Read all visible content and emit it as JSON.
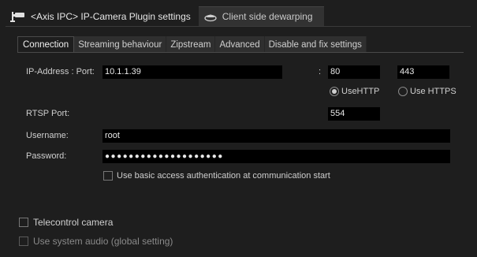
{
  "top_tabs": [
    {
      "label": "<Axis IPC> IP-Camera Plugin settings",
      "icon": "camera-icon"
    },
    {
      "label": "Client side dewarping",
      "icon": "dome-camera-icon"
    }
  ],
  "sub_tabs": [
    {
      "label": "Connection",
      "active": true
    },
    {
      "label": "Streaming behaviour"
    },
    {
      "label": "Zipstream"
    },
    {
      "label": "Advanced"
    },
    {
      "label": "Disable and fix settings"
    }
  ],
  "connection": {
    "ip_label": "IP-Address : Port:",
    "ip_value": "10.1.1.39",
    "colon": ":",
    "http_port": "80",
    "https_port": "443",
    "use_http_label": "UseHTTP",
    "use_https_label": "Use HTTPS",
    "use_http_selected": true,
    "rtsp_label": "RTSP Port:",
    "rtsp_port": "554",
    "username_label": "Username:",
    "username_value": "root",
    "password_label": "Password:",
    "password_value": "●●●●●●●●●●●●●●●●●●●●",
    "basic_auth_label": "Use basic access authentication at communication start",
    "basic_auth_checked": false
  },
  "footer": {
    "telecontrol_label": "Telecontrol camera",
    "telecontrol_checked": false,
    "system_audio_label": "Use system audio (global setting)",
    "system_audio_checked": false
  }
}
